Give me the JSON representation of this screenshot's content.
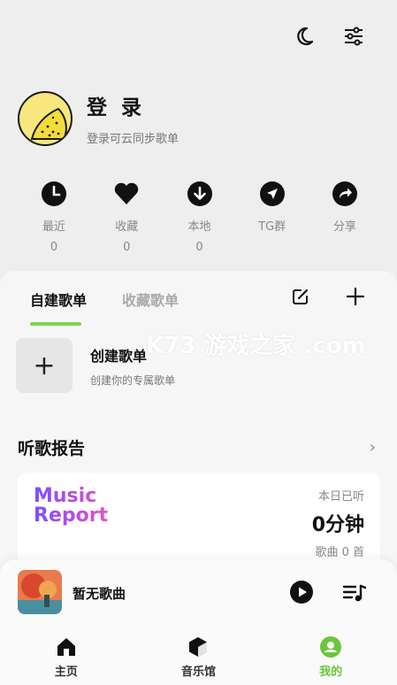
{
  "topbar": {
    "icons": [
      "moon-icon",
      "sliders-icon"
    ]
  },
  "profile": {
    "title": "登 录",
    "subtitle": "登录可云同步歌单"
  },
  "stats": [
    {
      "label": "最近",
      "count": "0",
      "icon": "clock-icon"
    },
    {
      "label": "收藏",
      "count": "0",
      "icon": "heart-icon"
    },
    {
      "label": "本地",
      "count": "0",
      "icon": "download-icon"
    },
    {
      "label": "TG群",
      "count": "",
      "icon": "telegram-icon"
    },
    {
      "label": "分享",
      "count": "",
      "icon": "share-icon"
    }
  ],
  "playlists": {
    "tabs": [
      "自建歌单",
      "收藏歌单"
    ],
    "active_tab": 0,
    "create_title": "创建歌单",
    "create_subtitle": "创建你的专属歌单"
  },
  "watermark": "K73 游戏之家 .com",
  "report": {
    "heading": "听歌报告",
    "logo_line1": "Music",
    "logo_line2": "Report",
    "today_label": "本日已听",
    "minutes": "0分钟",
    "songs": "歌曲 0 首"
  },
  "player": {
    "track": "暂无歌曲"
  },
  "nav": [
    {
      "label": "主页",
      "icon": "home-icon"
    },
    {
      "label": "音乐馆",
      "icon": "music-hall-icon"
    },
    {
      "label": "我的",
      "icon": "profile-icon"
    }
  ],
  "colors": {
    "accent": "#6cc63c",
    "logo_start": "#7c4dff",
    "logo_end": "#e254c5",
    "avatar": "#f7e77c"
  }
}
